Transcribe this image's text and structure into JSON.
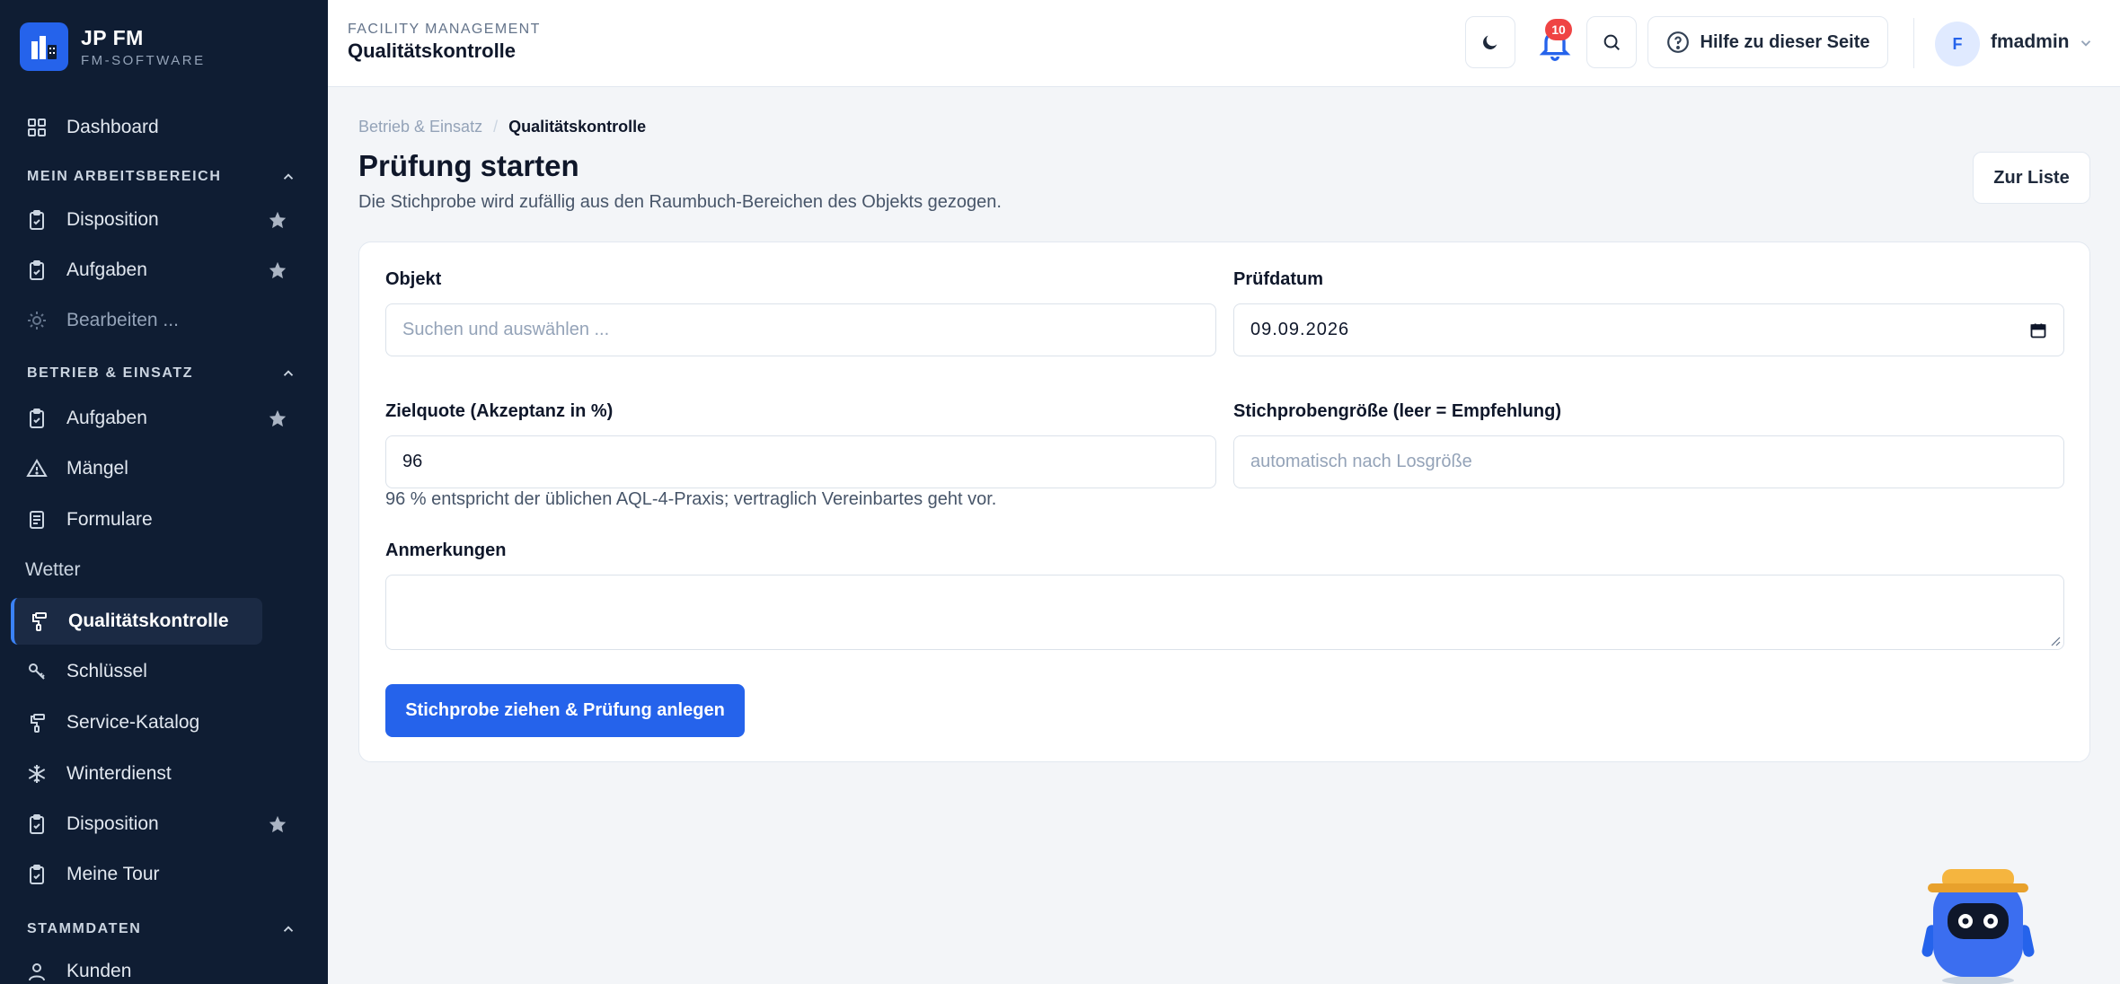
{
  "brand": {
    "name": "JP FM",
    "subtitle": "FM-SOFTWARE"
  },
  "sidebar": {
    "dashboard": "Dashboard",
    "section_workspace": "MEIN ARBEITSBEREICH",
    "workspace_items": [
      "Disposition",
      "Aufgaben",
      "Bearbeiten ..."
    ],
    "section_ops": "BETRIEB & EINSATZ",
    "ops_items": [
      "Aufgaben",
      "Mängel",
      "Formulare",
      "Wetter",
      "Qualitätskontrolle",
      "Schlüssel",
      "Service-Katalog",
      "Winterdienst",
      "Disposition",
      "Meine Tour"
    ],
    "section_master": "STAMMDATEN",
    "master_items": [
      "Kunden"
    ]
  },
  "header": {
    "overline": "FACILITY MANAGEMENT",
    "title": "Qualitätskontrolle",
    "notification_count": "10",
    "help_label": "Hilfe zu dieser Seite",
    "user_initial": "F",
    "user_name": "fmadmin"
  },
  "breadcrumb": {
    "parent": "Betrieb & Einsatz",
    "separator": "/",
    "current": "Qualitätskontrolle"
  },
  "page": {
    "title": "Prüfung starten",
    "subtitle": "Die Stichprobe wird zufällig aus den Raumbuch-Bereichen des Objekts gezogen.",
    "list_button": "Zur Liste"
  },
  "form": {
    "object_label": "Objekt",
    "object_placeholder": "Suchen und auswählen ...",
    "date_label": "Prüfdatum",
    "date_value": "09.09.2026",
    "quota_label": "Zielquote (Akzeptanz in %)",
    "quota_value": "96",
    "quota_help": "96 % entspricht der üblichen AQL-4-Praxis; vertraglich Vereinbartes geht vor.",
    "sample_label": "Stichprobengröße (leer = Empfehlung)",
    "sample_placeholder": "automatisch nach Losgröße",
    "notes_label": "Anmerkungen",
    "notes_value": "",
    "submit_label": "Stichprobe ziehen & Prüfung anlegen"
  },
  "colors": {
    "sidebar_bg": "#0f1d33",
    "accent": "#2563eb",
    "badge": "#ef4444"
  }
}
